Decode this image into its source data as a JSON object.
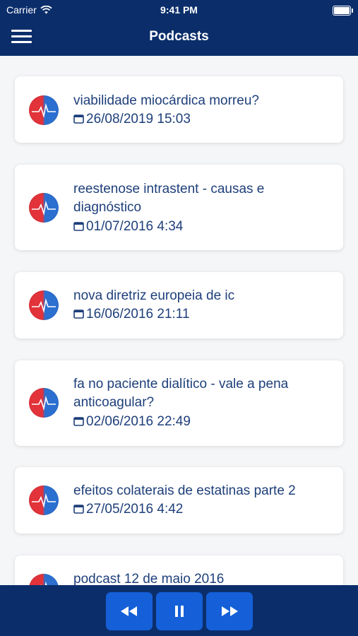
{
  "status_bar": {
    "carrier": "Carrier",
    "time": "9:41 PM",
    "battery_level": 1.0
  },
  "header": {
    "title": "Podcasts",
    "menu_icon": "hamburger-menu-icon"
  },
  "colors": {
    "header_bg": "#0b2e6b",
    "button_bg": "#1560d8",
    "text": "#1e3f7a"
  },
  "podcasts": [
    {
      "title": "viabilidade miocárdica morreu?",
      "date": "26/08/2019 15:03"
    },
    {
      "title": "reestenose intrastent - causas e diagnóstico",
      "date": "01/07/2016 4:34"
    },
    {
      "title": "nova diretriz europeia de ic",
      "date": "16/06/2016 21:11"
    },
    {
      "title": "fa no paciente dialítico - vale a pena anticoagular?",
      "date": "02/06/2016 22:49"
    },
    {
      "title": "efeitos colaterais de estatinas parte 2",
      "date": "27/05/2016 4:42"
    },
    {
      "title": "podcast 12 de maio 2016",
      "date": ""
    }
  ],
  "player": {
    "buttons": [
      "rewind-icon",
      "pause-icon",
      "fast-forward-icon"
    ]
  }
}
